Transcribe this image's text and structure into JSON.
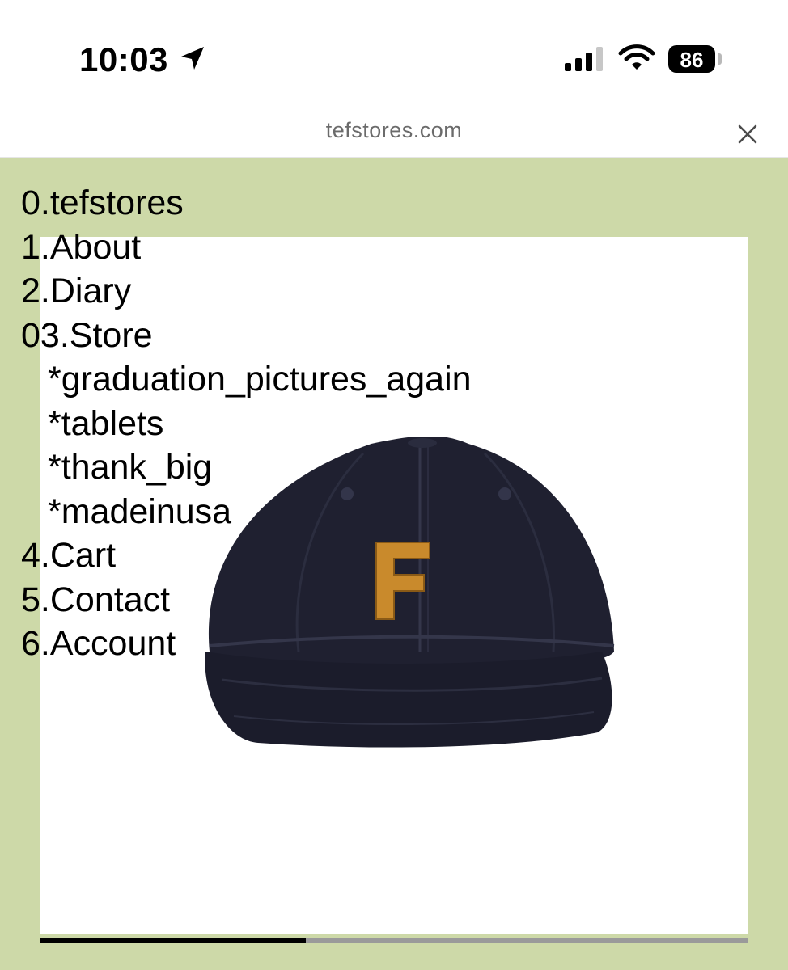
{
  "status_bar": {
    "time": "10:03",
    "battery": "86",
    "location_icon": "location-arrow-icon",
    "signal_icon": "cellular-signal-icon",
    "wifi_icon": "wifi-icon",
    "battery_icon": "battery-icon"
  },
  "browser": {
    "url": "tefstores.com",
    "close_icon": "close-icon"
  },
  "nav": {
    "items": [
      {
        "label": "0.tefstores"
      },
      {
        "label": "1.About"
      },
      {
        "label": "2.Diary"
      },
      {
        "label": "03.Store"
      },
      {
        "label": "*graduation_pictures_again"
      },
      {
        "label": "*tablets"
      },
      {
        "label": "*thank_big"
      },
      {
        "label": "*madeinusa"
      },
      {
        "label": "4.Cart"
      },
      {
        "label": "5.Contact"
      },
      {
        "label": "6.Account"
      }
    ]
  },
  "product": {
    "image_icon": "baseball-cap-image",
    "logo_letter": "F"
  },
  "slider": {
    "progress": 0.375
  },
  "colors": {
    "page_background": "#cdd9a8",
    "panel": "#ffffff",
    "cap": "#1f2030",
    "logo": "#c98a2c"
  }
}
